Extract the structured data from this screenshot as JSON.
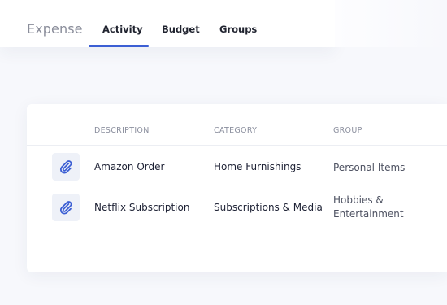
{
  "app": {
    "logo": "Expense"
  },
  "tabs": [
    {
      "label": "Activity",
      "active": true
    },
    {
      "label": "Budget",
      "active": false
    },
    {
      "label": "Groups",
      "active": false
    }
  ],
  "colors": {
    "accent": "#3c5fd4",
    "attach_icon": "#3c5fd4"
  },
  "table": {
    "headers": {
      "description": "DESCRIPTION",
      "category": "CATEGORY",
      "group": "GROUP"
    },
    "rows": [
      {
        "icon": "paperclip-icon",
        "description": "Amazon Order",
        "category": "Home Furnishings",
        "group": "Personal Items"
      },
      {
        "icon": "paperclip-icon",
        "description": "Netflix Subscription",
        "category": "Subscriptions & Media",
        "group": "Hobbies & Entertainment"
      }
    ]
  }
}
